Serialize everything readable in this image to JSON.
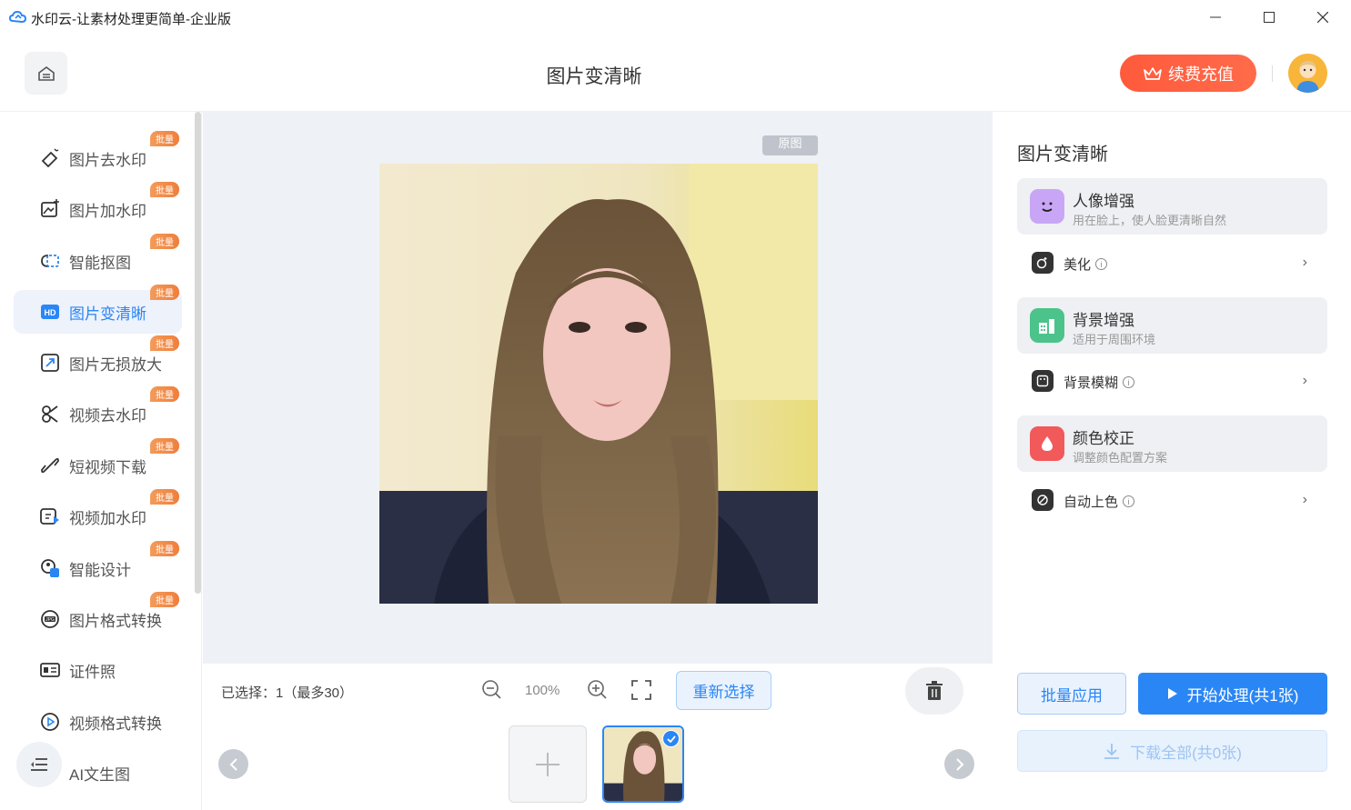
{
  "window": {
    "title": "水印云-让素材处理更简单-企业版",
    "min_icon": "minimize-icon",
    "max_icon": "maximize-icon",
    "close_icon": "close-icon"
  },
  "header": {
    "page_title": "图片变清晰",
    "recharge_label": "续费充值",
    "colors": {
      "recharge": "#ff5a3c",
      "accent": "#2b86f5"
    }
  },
  "sidebar": {
    "badge_text": "批量",
    "items": [
      {
        "label": "图片去水印",
        "icon": "eraser-icon",
        "badge": true
      },
      {
        "label": "图片加水印",
        "icon": "image-add-icon",
        "badge": true
      },
      {
        "label": "智能抠图",
        "icon": "cutout-icon",
        "badge": true
      },
      {
        "label": "图片变清晰",
        "icon": "hd-icon",
        "badge": true,
        "active": true
      },
      {
        "label": "图片无损放大",
        "icon": "enlarge-icon",
        "badge": true
      },
      {
        "label": "视频去水印",
        "icon": "video-eraser-icon",
        "badge": true
      },
      {
        "label": "短视频下载",
        "icon": "link-icon",
        "badge": true
      },
      {
        "label": "视频加水印",
        "icon": "video-add-icon",
        "badge": true
      },
      {
        "label": "智能设计",
        "icon": "design-icon",
        "badge": true
      },
      {
        "label": "图片格式转换",
        "icon": "jpg-convert-icon",
        "badge": true
      },
      {
        "label": "证件照",
        "icon": "id-photo-icon",
        "badge": false
      },
      {
        "label": "视频格式转换",
        "icon": "play-circle-icon",
        "badge": false
      },
      {
        "label": "AI文生图",
        "icon": "ai-image-icon",
        "badge": false
      }
    ]
  },
  "canvas": {
    "original_tag": "原图"
  },
  "toolbar": {
    "selected_text": "已选择：1（最多30）",
    "zoom": "100%",
    "reselect_label": "重新选择"
  },
  "panel": {
    "title": "图片变清晰",
    "groups": [
      {
        "title": "人像增强",
        "desc": "用在脸上，使人脸更清晰自然",
        "icon_color": "#c9a6f5",
        "option": "美化"
      },
      {
        "title": "背景增强",
        "desc": "适用于周围环境",
        "icon_color": "#4cc38a",
        "option": "背景模糊"
      },
      {
        "title": "颜色校正",
        "desc": "调整颜色配置方案",
        "icon_color": "#f2595b",
        "option": "自动上色"
      }
    ],
    "batch_label": "批量应用",
    "start_label": "开始处理(共1张)",
    "download_label": "下载全部(共0张)"
  }
}
